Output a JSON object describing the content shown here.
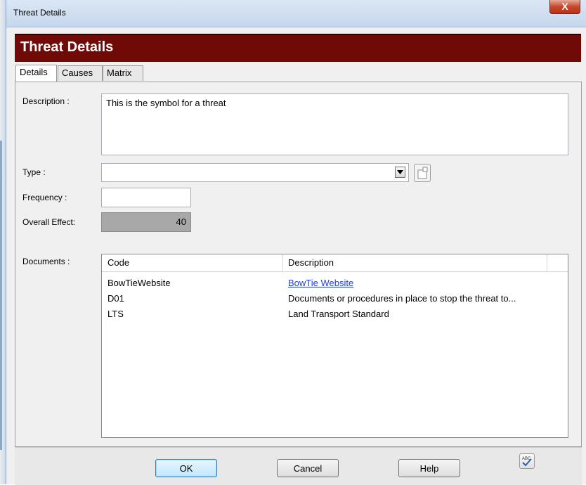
{
  "window": {
    "title": "Threat Details",
    "close_glyph": "X"
  },
  "header": {
    "title": "Threat Details"
  },
  "tabs": [
    {
      "label": "Details",
      "active": true
    },
    {
      "label": "Causes",
      "active": false
    },
    {
      "label": "Matrix",
      "active": false
    }
  ],
  "form": {
    "description_label": "Description :",
    "description_value": "This is the symbol for a threat",
    "type_label": "Type :",
    "type_value": "",
    "frequency_label": "Frequency :",
    "frequency_value": "",
    "overall_effect_label": "Overall Effect:",
    "overall_effect_value": "40",
    "documents_label": "Documents :"
  },
  "documents": {
    "columns": [
      "Code",
      "Description"
    ],
    "rows": [
      {
        "code": "BowTieWebsite",
        "description": "BowTie Website",
        "is_link": true
      },
      {
        "code": "D01",
        "description": "Documents or procedures in place to stop the threat to...",
        "is_link": false
      },
      {
        "code": "LTS",
        "description": "Land Transport Standard",
        "is_link": false
      }
    ]
  },
  "footer": {
    "ok_label": "OK",
    "cancel_label": "Cancel",
    "help_label": "Help"
  },
  "icons": {
    "combo_arrow": "dropdown-arrow-icon",
    "new_item": "new-item-icon",
    "spellcheck": "spellcheck-icon"
  },
  "colors": {
    "header_band": "#6f0a06",
    "link": "#1f3fe0",
    "close_button": "#c7482c"
  }
}
